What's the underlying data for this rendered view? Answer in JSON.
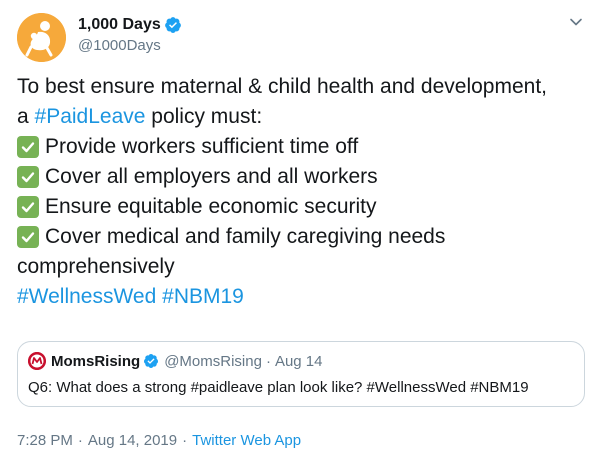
{
  "author": {
    "name": "1,000 Days",
    "handle": "@1000Days",
    "verified": true
  },
  "tweet": {
    "intro_line1": "To best ensure maternal & child health and development,",
    "intro_a": "a ",
    "intro_hashtag": "#PaidLeave",
    "intro_rest": " policy must:",
    "items": [
      "Provide workers sufficient time off",
      "Cover all employers and all workers",
      "Ensure equitable economic security",
      "Cover medical and family caregiving needs"
    ],
    "continuation": "comprehensively",
    "hashtag1": "#WellnessWed",
    "hashtag2": "#NBM19"
  },
  "quoted": {
    "name": "MomsRising",
    "handle": "@MomsRising",
    "dot": "·",
    "date": "Aug 14",
    "text": "Q6: What does a strong #paidleave plan look like? #WellnessWed #NBM19"
  },
  "meta": {
    "time": "7:28 PM",
    "date": "Aug 14, 2019",
    "separator": "·",
    "source": "Twitter Web App"
  },
  "colors": {
    "link": "#1b95e0",
    "secondary_text": "#657786",
    "check_green": "#77b255",
    "verified_blue": "#1da1f2",
    "avatar_orange": "#f6a93b"
  }
}
